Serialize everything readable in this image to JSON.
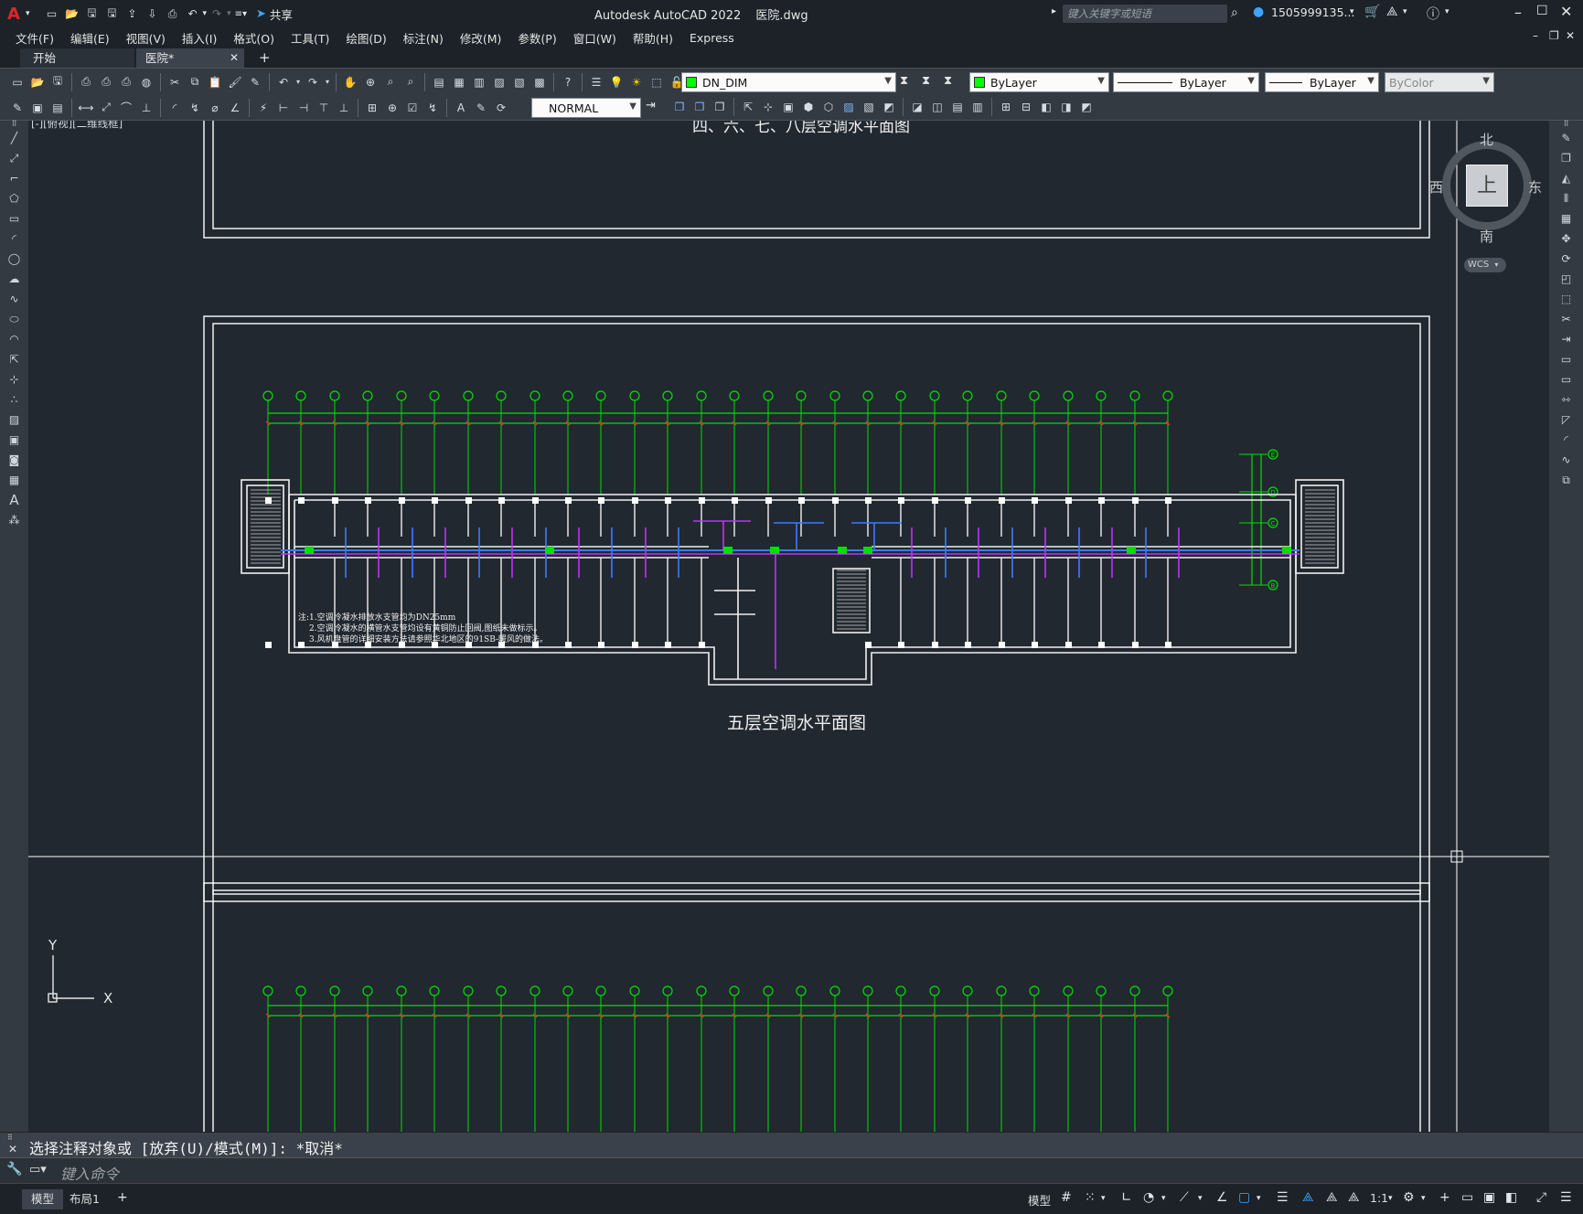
{
  "app": {
    "title": "Autodesk AutoCAD 2022",
    "filename": "医院.dwg",
    "logo": "A",
    "share_label": "共享",
    "search_placeholder": "键入关键字或短语",
    "user": "1505999135..."
  },
  "menu": [
    {
      "label": "文件(F)"
    },
    {
      "label": "编辑(E)"
    },
    {
      "label": "视图(V)"
    },
    {
      "label": "插入(I)"
    },
    {
      "label": "格式(O)"
    },
    {
      "label": "工具(T)"
    },
    {
      "label": "绘图(D)"
    },
    {
      "label": "标注(N)"
    },
    {
      "label": "修改(M)"
    },
    {
      "label": "参数(P)"
    },
    {
      "label": "窗口(W)"
    },
    {
      "label": "帮助(H)"
    },
    {
      "label": "Express"
    }
  ],
  "tabs": [
    {
      "label": "开始"
    },
    {
      "label": "医院*"
    }
  ],
  "toolbar": {
    "layer": "DN_DIM",
    "layer_color": "#00ff00",
    "color_label": "ByLayer",
    "linetype": "ByLayer",
    "lineweight": "ByLayer",
    "plotstyle": "ByColor",
    "text_style": "NORMAL"
  },
  "viewport": {
    "label": "[-][俯视][二维线框]"
  },
  "viewcube": {
    "north": "北",
    "south": "南",
    "east": "东",
    "west": "西",
    "face": "上",
    "wcs": "WCS"
  },
  "drawing": {
    "top_title": "四、六、七、八层空调水平面图",
    "main_title": "五层空调水平面图",
    "notes": [
      "注:1.空调冷凝水排放水支管均为DN25mm",
      "2.空调冷凝水的横管水支管均设有黄铜防止回阀,图纸未做标示。",
      "3.风机盘管的详细安装方法请参照华北地区的91SB-暖风的做法。"
    ],
    "axis_row_labels": [
      "E",
      "D",
      "C",
      "B"
    ],
    "axis_col_count": 28,
    "overall_dim": "82800"
  },
  "ucs": {
    "x": "X",
    "y": "Y"
  },
  "command": {
    "history": "选择注释对象或 [放弃(U)/模式(M)]: *取消*",
    "placeholder": "键入命令"
  },
  "status": {
    "model_tab": "模型",
    "layout_tab": "布局1",
    "model_label": "模型",
    "scale": "1:1"
  },
  "colors": {
    "grid_green": "#00e000",
    "wall_white": "#f0f0f0",
    "pipe_blue": "#3c7bff",
    "pipe_magenta": "#c030ff",
    "accent_red": "#ff2020"
  }
}
